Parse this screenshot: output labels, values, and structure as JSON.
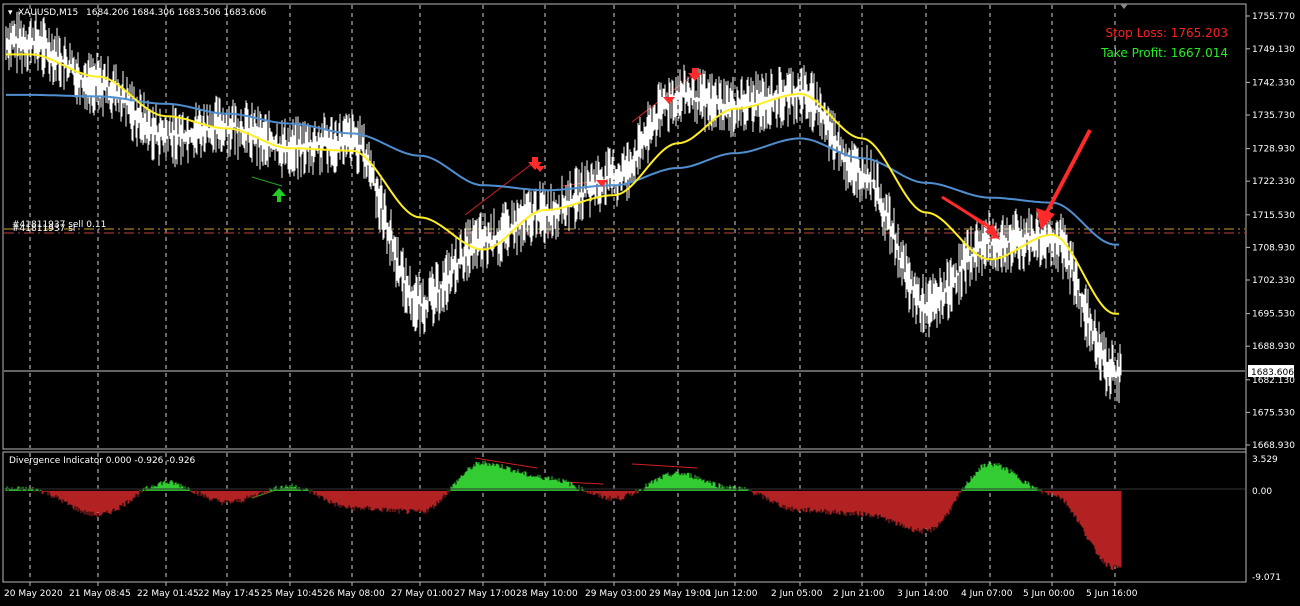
{
  "chart_header": {
    "menu_glyph": "▾",
    "symbol_text": "XAUUSD,M15",
    "ohlc_text": "1684.206 1684.306 1683.506 1683.606"
  },
  "trade_info": {
    "stop_loss_text": "Stop Loss: 1765.203",
    "stop_loss_color": "#ff2020",
    "take_profit_text": "Take Profit: 1667.014",
    "take_profit_color": "#22ee22"
  },
  "order_labels": {
    "line1": "#41811937 sell 0.11",
    "line2": "#41811937 sl"
  },
  "price_axis": {
    "ticks": [
      "1755.770",
      "1749.130",
      "1742.330",
      "1735.730",
      "1728.930",
      "1722.330",
      "1715.530",
      "1708.930",
      "1702.330",
      "1695.530",
      "1688.930",
      "1682.130",
      "1675.530",
      "1668.930"
    ],
    "current_price": "1683.606"
  },
  "indicator": {
    "title": "Divergence Indicator 0.000 -0.926 -0.926",
    "ticks": [
      "3.529",
      "0.00",
      "-9.071"
    ],
    "positive_color": "#33cc33",
    "negative_color": "#b22222"
  },
  "time_axis": {
    "ticks": [
      "20 May 2020",
      "21 May 08:45",
      "22 May 01:45",
      "22 May 17:45",
      "25 May 10:45",
      "26 May 08:00",
      "27 May 01:00",
      "27 May 17:00",
      "28 May 10:00",
      "29 May 03:00",
      "29 May 19:00",
      "1 Jun 12:00",
      "2 Jun 05:00",
      "2 Jun 21:00",
      "3 Jun 14:00",
      "4 Jun 07:00",
      "5 Jun 00:00",
      "5 Jun 16:00"
    ]
  },
  "colors": {
    "ma_fast": "#ffee22",
    "ma_slow": "#4f8fd0",
    "price_line": "#ffffff",
    "arrow_red": "#ff2a2a",
    "arrow_green": "#22cc22"
  },
  "chart_data": {
    "type": "line",
    "title": "XAUUSD,M15",
    "ylim": [
      1668.93,
      1755.77
    ],
    "x": [
      "20 May 2020",
      "21 May 08:45",
      "22 May 01:45",
      "22 May 17:45",
      "25 May 10:45",
      "26 May 08:00",
      "27 May 01:00",
      "27 May 17:00",
      "28 May 10:00",
      "29 May 03:00",
      "29 May 19:00",
      "1 Jun 12:00",
      "2 Jun 05:00",
      "2 Jun 21:00",
      "3 Jun 14:00",
      "4 Jun 07:00",
      "5 Jun 00:00",
      "5 Jun 16:00"
    ],
    "series": [
      {
        "name": "price",
        "values": [
          1750.5,
          1742.0,
          1731.5,
          1733.5,
          1729.0,
          1730.5,
          1697.5,
          1710.0,
          1716.0,
          1723.0,
          1739.5,
          1737.5,
          1740.0,
          1724.0,
          1697.0,
          1710.0,
          1711.0,
          1683.6
        ]
      },
      {
        "name": "MA fast",
        "values": [
          1748.0,
          1743.5,
          1735.5,
          1733.0,
          1729.0,
          1728.5,
          1715.0,
          1708.5,
          1716.5,
          1719.5,
          1730.0,
          1737.0,
          1740.0,
          1731.0,
          1716.0,
          1706.5,
          1711.5,
          1695.5
        ]
      },
      {
        "name": "MA slow",
        "values": [
          1739.8,
          1739.5,
          1738.0,
          1736.0,
          1734.0,
          1732.0,
          1727.5,
          1721.5,
          1720.5,
          1721.5,
          1725.0,
          1728.0,
          1731.0,
          1727.0,
          1722.0,
          1719.0,
          1718.0,
          1709.5
        ]
      }
    ],
    "horizontal_lines": [
      1712.0,
      1711.6,
      1683.606
    ],
    "indicator": {
      "name": "Divergence Indicator",
      "ylim": [
        -9.071,
        3.529
      ],
      "x": [
        "20 May 2020",
        "21 May 08:45",
        "22 May 01:45",
        "22 May 17:45",
        "25 May 10:45",
        "26 May 08:00",
        "27 May 01:00",
        "27 May 17:00",
        "28 May 10:00",
        "29 May 03:00",
        "29 May 19:00",
        "1 Jun 12:00",
        "2 Jun 05:00",
        "2 Jun 21:00",
        "3 Jun 14:00",
        "4 Jun 07:00",
        "5 Jun 00:00",
        "5 Jun 16:00"
      ],
      "values": [
        0.2,
        -2.5,
        0.9,
        -1.2,
        0.5,
        -1.8,
        -2.2,
        2.9,
        1.4,
        -0.8,
        1.8,
        0.3,
        -2.0,
        -2.4,
        -4.2,
        2.8,
        -0.3,
        -8.0
      ]
    }
  }
}
